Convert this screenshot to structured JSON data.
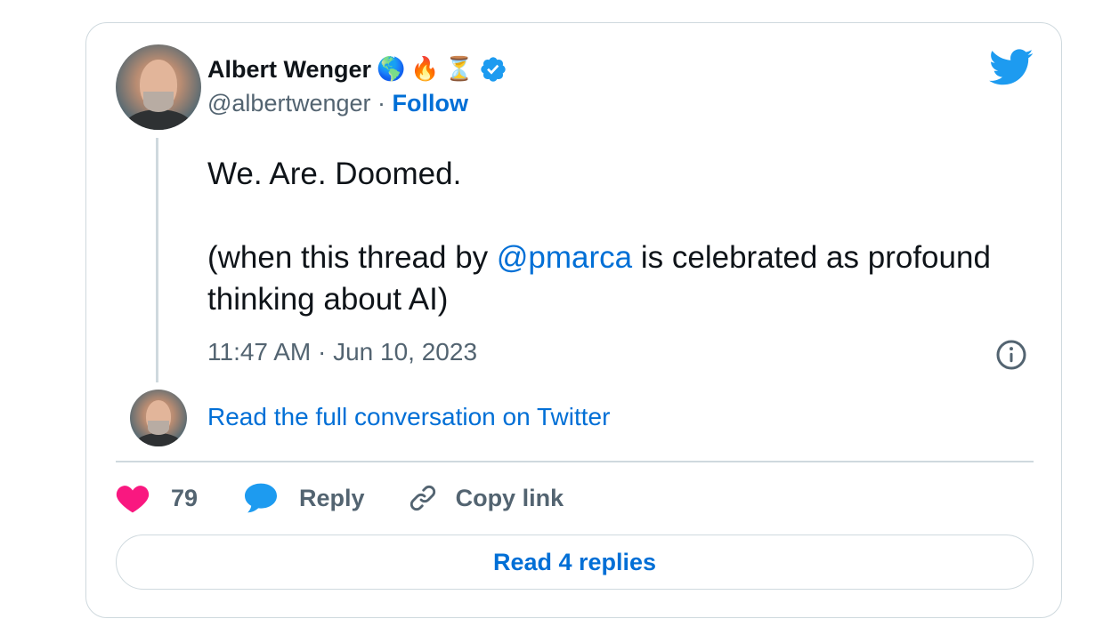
{
  "author": {
    "name": "Albert Wenger",
    "emojis": [
      "🌎",
      "🔥",
      "⏳"
    ],
    "handle": "@albertwenger",
    "separator": "·",
    "follow_label": "Follow"
  },
  "tweet": {
    "line1": "We. Are. Doomed.",
    "line2_prefix": "(when this thread by ",
    "mention": "@pmarca",
    "line2_suffix": " is celebrated as profound thinking about AI)",
    "timestamp": "11:47 AM · Jun 10, 2023"
  },
  "conversation_link": "Read the full conversation on Twitter",
  "actions": {
    "like_count": "79",
    "reply_label": "Reply",
    "copy_label": "Copy link"
  },
  "read_replies_label": "Read 4 replies",
  "colors": {
    "link": "#006fd6",
    "twitter_blue": "#1d9bf0",
    "like": "#f91880",
    "text": "#0f1419",
    "muted": "#536471",
    "border": "#cfd9de"
  },
  "icons": [
    "twitter-bird-icon",
    "verified-badge-icon",
    "info-icon",
    "heart-icon",
    "reply-bubble-icon",
    "link-icon"
  ]
}
